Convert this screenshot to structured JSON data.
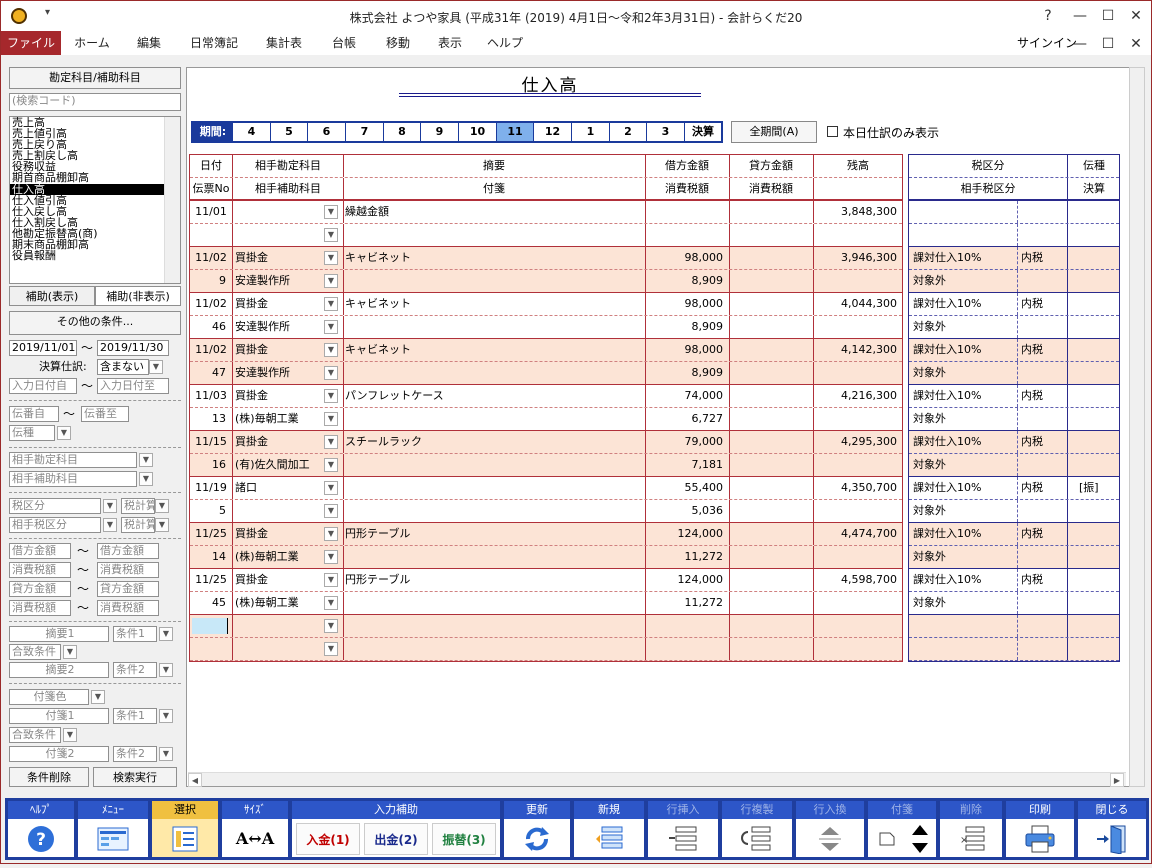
{
  "window": {
    "title": "株式会社 よつや家具 (平成31年 (2019) 4月1日～令和2年3月31日) - 会計らくだ20",
    "help": "?",
    "minimize": "—",
    "maximize": "☐",
    "close": "✕"
  },
  "menu": {
    "items": [
      "ファイル",
      "ホーム",
      "編集",
      "日常簿記",
      "集計表",
      "台帳",
      "移動",
      "表示",
      "ヘルプ"
    ],
    "signin": "サインイン"
  },
  "left": {
    "header": "勘定科目/補助科目",
    "search_placeholder": "(検索コード)",
    "accounts": [
      "売上高",
      "売上値引高",
      "売上戻り高",
      "売上割戻し高",
      "役務収益",
      "期首商品棚卸高",
      "仕入高",
      "仕入値引高",
      "仕入戻し高",
      "仕入割戻し高",
      "他勘定振替高(商)",
      "期末商品棚卸高",
      "役員報酬"
    ],
    "selected_account": "仕入高",
    "show_sub": "補助(表示)",
    "hide_sub": "補助(非表示)",
    "other_conditions": "その他の条件...",
    "date_from": "2019/11/01",
    "date_to": "2019/11/30",
    "tilde": "～",
    "closing_label": "決算仕訳:",
    "closing_value": "含まない",
    "input_date_from": "入力日付自",
    "input_date_to": "入力日付至",
    "voucher_from": "伝番自",
    "voucher_to": "伝番至",
    "voucher_type": "伝種",
    "counter_account": "相手勘定科目",
    "counter_sub": "相手補助科目",
    "tax_class": "税区分",
    "tax_calc": "税計算",
    "counter_tax": "相手税区分",
    "debit_from": "借方金額",
    "debit_to": "借方金額",
    "debit_tax_from": "消費税額",
    "debit_tax_to": "消費税額",
    "credit_from": "貸方金額",
    "credit_to": "貸方金額",
    "credit_tax_from": "消費税額",
    "credit_tax_to": "消費税額",
    "memo1": "摘要1",
    "cond1": "条件1",
    "match_cond": "合致条件",
    "memo2": "摘要2",
    "cond2": "条件2",
    "tag_color": "付箋色",
    "tag1": "付箋1",
    "tag_cond1": "条件1",
    "tag_match": "合致条件",
    "tag2": "付箋2",
    "tag_cond2": "条件2",
    "clear_btn": "条件削除",
    "search_btn": "検索実行"
  },
  "report": {
    "title": "仕入高",
    "period_label": "期間:",
    "periods": [
      "4",
      "5",
      "6",
      "7",
      "8",
      "9",
      "10",
      "11",
      "12",
      "1",
      "2",
      "3",
      "決算"
    ],
    "selected_period": "11",
    "all_period": "全期間(A)",
    "today_only": "本日仕訳のみ表示",
    "headers": {
      "date": "日付",
      "voucher": "伝票No",
      "counter_account": "相手勘定科目",
      "counter_sub": "相手補助科目",
      "memo": "摘要",
      "tag": "付箋",
      "debit": "借方金額",
      "debit_tax": "消費税額",
      "credit": "貸方金額",
      "credit_tax": "消費税額",
      "balance": "残高",
      "tax_class": "税区分",
      "counter_tax": "相手税区分",
      "vtype": "伝種",
      "closing": "決算"
    },
    "carry": {
      "date": "11/01",
      "memo": "繰越金額",
      "balance": "3,848,300"
    },
    "rows": [
      {
        "date": "11/02",
        "no": "9",
        "acct": "買掛金",
        "sub": "安達製作所",
        "memo": "キャビネット",
        "debit": "98,000",
        "tax": "8,909",
        "balance": "3,946,300",
        "tax_class": "課対仕入10%",
        "incl": "内税",
        "counter_tax": "対象外",
        "vtype": ""
      },
      {
        "date": "11/02",
        "no": "46",
        "acct": "買掛金",
        "sub": "安達製作所",
        "memo": "キャビネット",
        "debit": "98,000",
        "tax": "8,909",
        "balance": "4,044,300",
        "tax_class": "課対仕入10%",
        "incl": "内税",
        "counter_tax": "対象外",
        "vtype": ""
      },
      {
        "date": "11/02",
        "no": "47",
        "acct": "買掛金",
        "sub": "安達製作所",
        "memo": "キャビネット",
        "debit": "98,000",
        "tax": "8,909",
        "balance": "4,142,300",
        "tax_class": "課対仕入10%",
        "incl": "内税",
        "counter_tax": "対象外",
        "vtype": ""
      },
      {
        "date": "11/03",
        "no": "13",
        "acct": "買掛金",
        "sub": "(株)毎朝工業",
        "memo": "パンフレットケース",
        "debit": "74,000",
        "tax": "6,727",
        "balance": "4,216,300",
        "tax_class": "課対仕入10%",
        "incl": "内税",
        "counter_tax": "対象外",
        "vtype": ""
      },
      {
        "date": "11/15",
        "no": "16",
        "acct": "買掛金",
        "sub": "(有)佐久間加工",
        "memo": "スチールラック",
        "debit": "79,000",
        "tax": "7,181",
        "balance": "4,295,300",
        "tax_class": "課対仕入10%",
        "incl": "内税",
        "counter_tax": "対象外",
        "vtype": ""
      },
      {
        "date": "11/19",
        "no": "5",
        "acct": "諸口",
        "sub": "",
        "memo": "",
        "debit": "55,400",
        "tax": "5,036",
        "balance": "4,350,700",
        "tax_class": "課対仕入10%",
        "incl": "内税",
        "counter_tax": "対象外",
        "vtype": "[振]"
      },
      {
        "date": "11/25",
        "no": "14",
        "acct": "買掛金",
        "sub": "(株)毎朝工業",
        "memo": "円形テーブル",
        "debit": "124,000",
        "tax": "11,272",
        "balance": "4,474,700",
        "tax_class": "課対仕入10%",
        "incl": "内税",
        "counter_tax": "対象外",
        "vtype": ""
      },
      {
        "date": "11/25",
        "no": "45",
        "acct": "買掛金",
        "sub": "(株)毎朝工業",
        "memo": "円形テーブル",
        "debit": "124,000",
        "tax": "11,272",
        "balance": "4,598,700",
        "tax_class": "課対仕入10%",
        "incl": "内税",
        "counter_tax": "対象外",
        "vtype": ""
      }
    ]
  },
  "toolbar": {
    "help": "ﾍﾙﾌﾟ",
    "menu": "ﾒﾆｭｰ",
    "select": "選択",
    "size": "ｻｲｽﾞ",
    "input_assist": "入力補助",
    "nyukin": "入金(1)",
    "shukkin": "出金(2)",
    "furikae": "振替(3)",
    "update": "更新",
    "new": "新規",
    "row_insert": "行挿入",
    "row_copy": "行複製",
    "row_swap": "行入換",
    "tag": "付箋",
    "delete": "削除",
    "print": "印刷",
    "close": "閉じる"
  }
}
